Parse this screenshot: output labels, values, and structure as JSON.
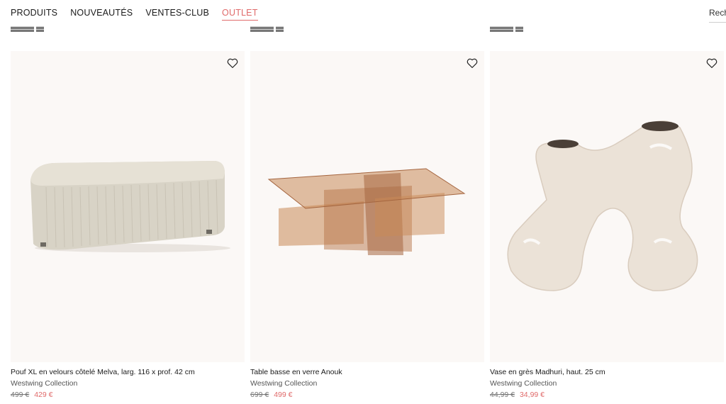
{
  "nav": {
    "items": [
      {
        "label": "PRODUITS",
        "active": false
      },
      {
        "label": "NOUVEAUTÉS",
        "active": false
      },
      {
        "label": "VENTES-CLUB",
        "active": false
      },
      {
        "label": "OUTLET",
        "active": true
      }
    ],
    "search_text": "Rech"
  },
  "products": [
    {
      "title": "Pouf XL en velours côtelé Melva, larg. 116 x prof. 42 cm",
      "brand": "Westwing Collection",
      "old_price": "499 €",
      "new_price": "429 €",
      "image": "corduroy-ottoman"
    },
    {
      "title": "Table basse en verre Anouk",
      "brand": "Westwing Collection",
      "old_price": "699 €",
      "new_price": "499 €",
      "image": "glass-coffee-table"
    },
    {
      "title": "Vase en grès Madhuri, haut. 25 cm",
      "brand": "Westwing Collection",
      "old_price": "44,99 €",
      "new_price": "34,99 €",
      "image": "sculptural-vase"
    }
  ],
  "colors": {
    "accent": "#e06a6a",
    "card_bg": "#fbf8f6"
  }
}
